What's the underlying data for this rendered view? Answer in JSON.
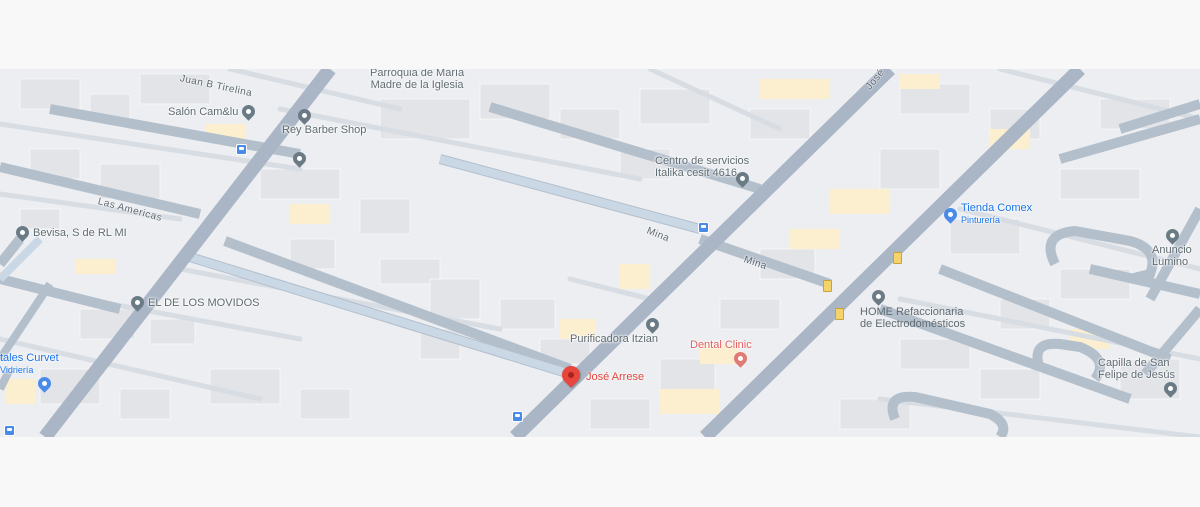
{
  "map": {
    "streets": {
      "juan_tirelina": "Juan B Tirelina",
      "las_americas": "Las Americas",
      "mina_1": "Mina",
      "mina_2": "Mina",
      "jose": "José"
    },
    "places": {
      "parroquia": "Parroquia de María\nMadre de la Iglesia",
      "salon": "Salón Cam&lu",
      "rey_barber": "Rey Barber Shop",
      "centro_servicios": "Centro de servicios\nItalika cesit 4616",
      "tienda_comex": "Tienda Comex",
      "tienda_comex_sub": "Pinturería",
      "anuncios": "Anuncio\nLumino",
      "bevisa": "Bevisa, S de RL MI",
      "el_de_los_movidos": "EL DE LOS MOVIDOS",
      "home_refaccionaria": "HOME Refaccionaria\nde Electrodomésticos",
      "purificadora": "Purificadora Itzian",
      "dental_clinic": "Dental Clinic",
      "capilla": "Capilla de San\nFelipe de Jesús",
      "tales_curvet": "tales Curvet",
      "tales_curvet_sub": "Vidriería",
      "jose_arrese": "José Arrese"
    },
    "colors": {
      "road": "#aab6c6",
      "land": "#eceef1",
      "accent_red": "#ea4335",
      "poi_blue": "#4a8ae8"
    }
  }
}
